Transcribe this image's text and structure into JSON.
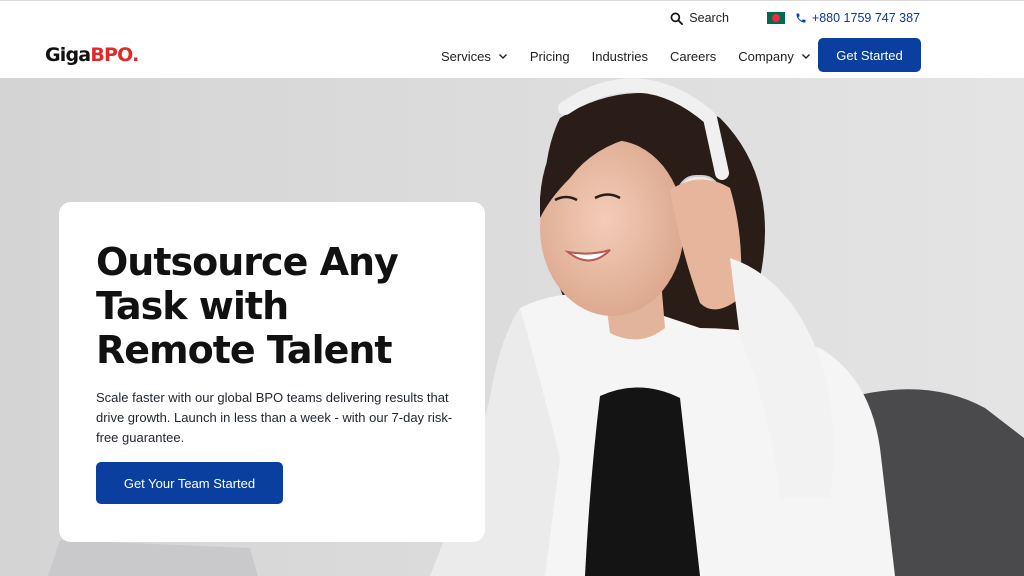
{
  "header": {
    "logo": {
      "part1": "Giga",
      "part2": "BPO",
      "dot": "."
    },
    "topbar": {
      "search_label": "Search",
      "flag_icon": "bangladesh-flag-icon",
      "phone": "+880 1759 747 387"
    },
    "nav": {
      "items": [
        {
          "label": "Services",
          "has_dropdown": true
        },
        {
          "label": "Pricing",
          "has_dropdown": false
        },
        {
          "label": "Industries",
          "has_dropdown": false
        },
        {
          "label": "Careers",
          "has_dropdown": false
        },
        {
          "label": "Company",
          "has_dropdown": true
        }
      ]
    },
    "cta_label": "Get Started"
  },
  "hero": {
    "title": "Outsource Any Task with Remote Talent",
    "description": "Scale faster with our global BPO teams delivering results that drive growth. Launch in less than a week - with our 7-day risk-free guarantee.",
    "button_label": "Get Your Team Started",
    "image": "woman-with-headphones-photo"
  },
  "colors": {
    "primary": "#0a3fa0",
    "logo_red": "#e02a2a",
    "text": "#111111",
    "hero_bg": "#d9d9d9"
  }
}
